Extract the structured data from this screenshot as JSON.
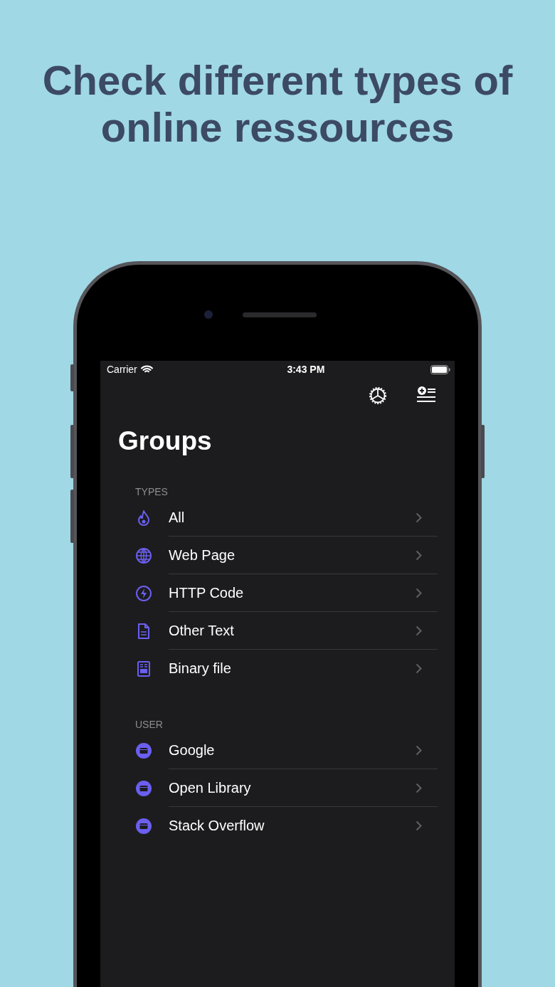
{
  "headline": "Check different types of online ressources",
  "status_bar": {
    "carrier": "Carrier",
    "time": "3:43 PM"
  },
  "title": "Groups",
  "sections": [
    {
      "header": "TYPES",
      "items": [
        {
          "label": "All",
          "kind": "flame"
        },
        {
          "label": "Web Page",
          "kind": "globe"
        },
        {
          "label": "HTTP Code",
          "kind": "bolt"
        },
        {
          "label": "Other Text",
          "kind": "document"
        },
        {
          "label": "Binary file",
          "kind": "binary"
        }
      ]
    },
    {
      "header": "USER",
      "items": [
        {
          "label": "Google",
          "kind": "folder"
        },
        {
          "label": "Open Library",
          "kind": "folder"
        },
        {
          "label": "Stack Overflow",
          "kind": "folder"
        }
      ]
    }
  ]
}
